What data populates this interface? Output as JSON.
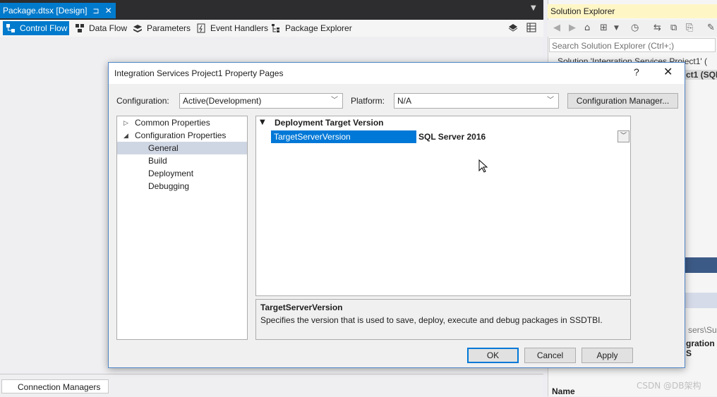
{
  "document_tab": {
    "title": "Package.dtsx [Design]",
    "pin_glyph": "⊐",
    "close_glyph": "✕"
  },
  "designer_tabs": [
    "Control Flow",
    "Data Flow",
    "Parameters",
    "Event Handlers",
    "Package Explorer"
  ],
  "connection_managers_tab": "Connection Managers",
  "solution_explorer": {
    "title": "Solution Explorer",
    "search_placeholder": "Search Solution Explorer (Ctrl+;)",
    "tree_partial_1": "Solution 'Integration Services Project1' (",
    "tree_partial_2": "ct1 (SQL",
    "props_partial_1": "sers\\Sub",
    "props_partial_2": "gration S",
    "props_name_label": "Name"
  },
  "watermark": "CSDN @DB架构",
  "dialog": {
    "title": "Integration Services Project1 Property Pages",
    "help": "?",
    "close": "✕",
    "configuration_label": "Configuration:",
    "configuration_value": "Active(Development)",
    "platform_label": "Platform:",
    "platform_value": "N/A",
    "config_manager_button": "Configuration Manager...",
    "tree": {
      "common_properties": "Common Properties",
      "configuration_properties": "Configuration Properties",
      "general": "General",
      "build": "Build",
      "deployment": "Deployment",
      "debugging": "Debugging"
    },
    "grid": {
      "category": "Deployment Target Version",
      "property_name": "TargetServerVersion",
      "property_value": "SQL Server 2016"
    },
    "description": {
      "title": "TargetServerVersion",
      "text": "Specifies the version that is used to save, deploy, execute and debug packages in SSDTBI."
    },
    "buttons": {
      "ok": "OK",
      "cancel": "Cancel",
      "apply": "Apply"
    }
  }
}
